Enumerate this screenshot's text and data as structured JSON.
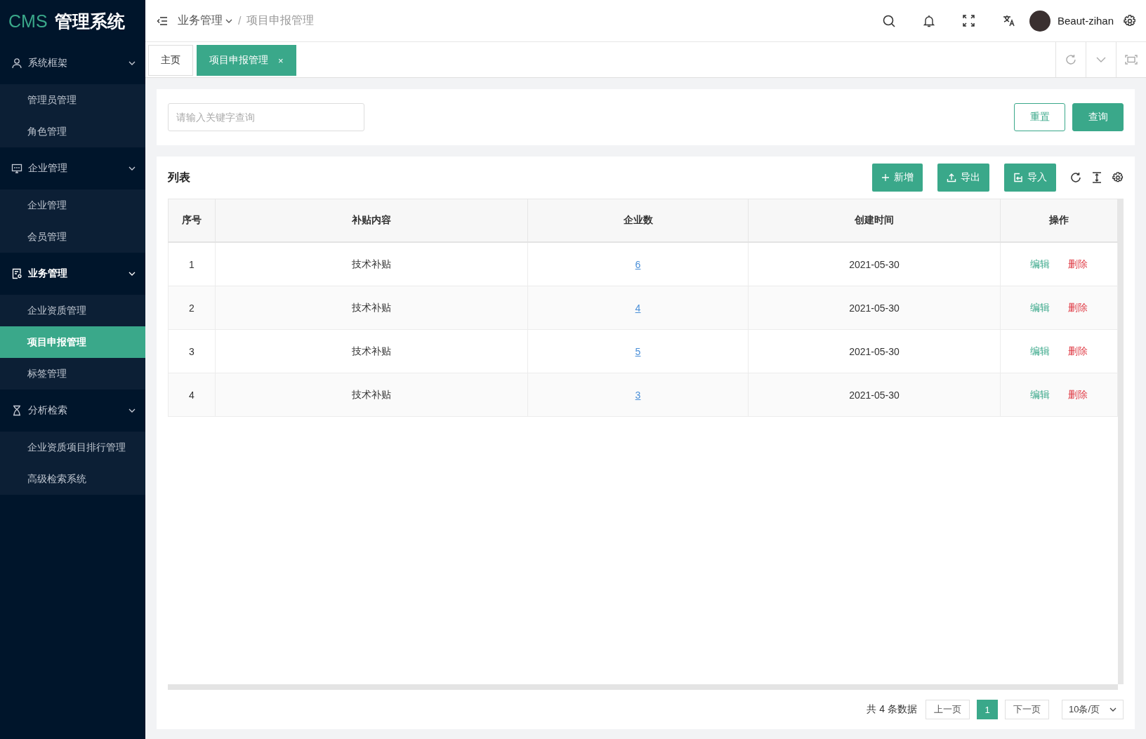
{
  "logo": {
    "brand": "CMS",
    "title": "管理系统"
  },
  "sidebar": {
    "groups": [
      {
        "label": "系统框架",
        "active": false,
        "children": [
          {
            "label": "管理员管理",
            "selected": false
          },
          {
            "label": "角色管理",
            "selected": false
          }
        ]
      },
      {
        "label": "企业管理",
        "active": false,
        "children": [
          {
            "label": "企业管理",
            "selected": false
          },
          {
            "label": "会员管理",
            "selected": false
          }
        ]
      },
      {
        "label": "业务管理",
        "active": true,
        "children": [
          {
            "label": "企业资质管理",
            "selected": false
          },
          {
            "label": "项目申报管理",
            "selected": true
          },
          {
            "label": "标签管理",
            "selected": false
          }
        ]
      },
      {
        "label": "分析检索",
        "active": false,
        "children": [
          {
            "label": "企业资质项目排行管理",
            "selected": false
          },
          {
            "label": "高级检索系统",
            "selected": false
          }
        ]
      }
    ]
  },
  "breadcrumb_separator": "/",
  "breadcrumb": [
    {
      "label": "业务管理",
      "dropdown": true
    },
    {
      "label": "项目申报管理",
      "dropdown": false
    }
  ],
  "user": {
    "name": "Beaut-zihan"
  },
  "tabs": [
    {
      "label": "主页",
      "selected": false,
      "closable": false
    },
    {
      "label": "项目申报管理",
      "selected": true,
      "closable": true
    }
  ],
  "tab_close": "×",
  "search": {
    "placeholder": "请输入关键字查询",
    "buttons": [
      {
        "label": "重置",
        "kind": "outline"
      },
      {
        "label": "查询",
        "kind": "primary"
      }
    ]
  },
  "list": {
    "title": "列表",
    "actions": [
      {
        "label": "新增"
      },
      {
        "label": "导出"
      },
      {
        "label": "导入"
      }
    ]
  },
  "table": {
    "columns": [
      "序号",
      "补贴内容",
      "企业数",
      "创建时间",
      "操作"
    ],
    "rows": [
      {
        "index": "1",
        "content": "技术补贴",
        "count": "6",
        "created": "2021-05-30",
        "actions": [
          "编辑",
          "删除"
        ]
      },
      {
        "index": "2",
        "content": "技术补贴",
        "count": "4",
        "created": "2021-05-30",
        "actions": [
          "编辑",
          "删除"
        ]
      },
      {
        "index": "3",
        "content": "技术补贴",
        "count": "5",
        "created": "2021-05-30",
        "actions": [
          "编辑",
          "删除"
        ]
      },
      {
        "index": "4",
        "content": "技术补贴",
        "count": "3",
        "created": "2021-05-30",
        "actions": [
          "编辑",
          "删除"
        ]
      }
    ]
  },
  "pagination": {
    "total": "共 4 条数据",
    "prev": "上一页",
    "pages": [
      {
        "label": "1",
        "selected": true
      }
    ],
    "next": "下一页",
    "page_size": "10条/页"
  }
}
